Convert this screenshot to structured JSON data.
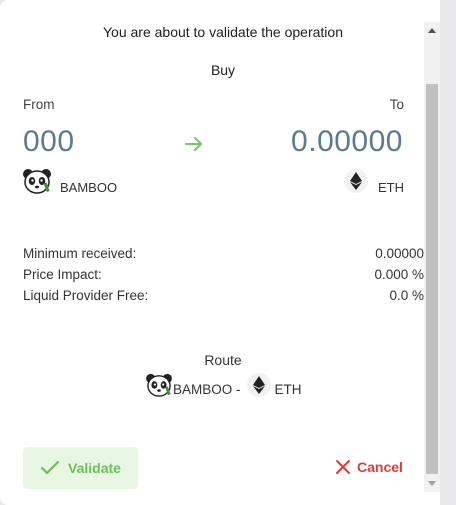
{
  "dialog": {
    "title": "You are about to validate the operation",
    "action": "Buy"
  },
  "swap": {
    "from_label": "From",
    "to_label": "To",
    "from_amount": "000",
    "to_amount": "0.00000",
    "from_token": "BAMBOO",
    "to_token": "ETH"
  },
  "details": {
    "min_received_label": "Minimum received:",
    "min_received_value": "0.00000",
    "price_impact_label": "Price Impact:",
    "price_impact_value": "0.000 %",
    "lp_fee_label": "Liquid Provider Free:",
    "lp_fee_value": "0.0 %"
  },
  "route": {
    "title": "Route",
    "from": "BAMBOO -",
    "to": "ETH"
  },
  "actions": {
    "validate_label": "Validate",
    "cancel_label": "Cancel"
  },
  "colors": {
    "amount": "#5a7a96",
    "arrow": "#7ac36a",
    "validate_text": "#6cbf5a",
    "validate_bg": "#e8f7e4",
    "cancel": "#e53935"
  },
  "icons": {
    "arrow": "arrow-right-icon",
    "bamboo": "panda-icon",
    "eth": "ethereum-icon",
    "validate": "check-icon",
    "cancel": "close-icon"
  }
}
